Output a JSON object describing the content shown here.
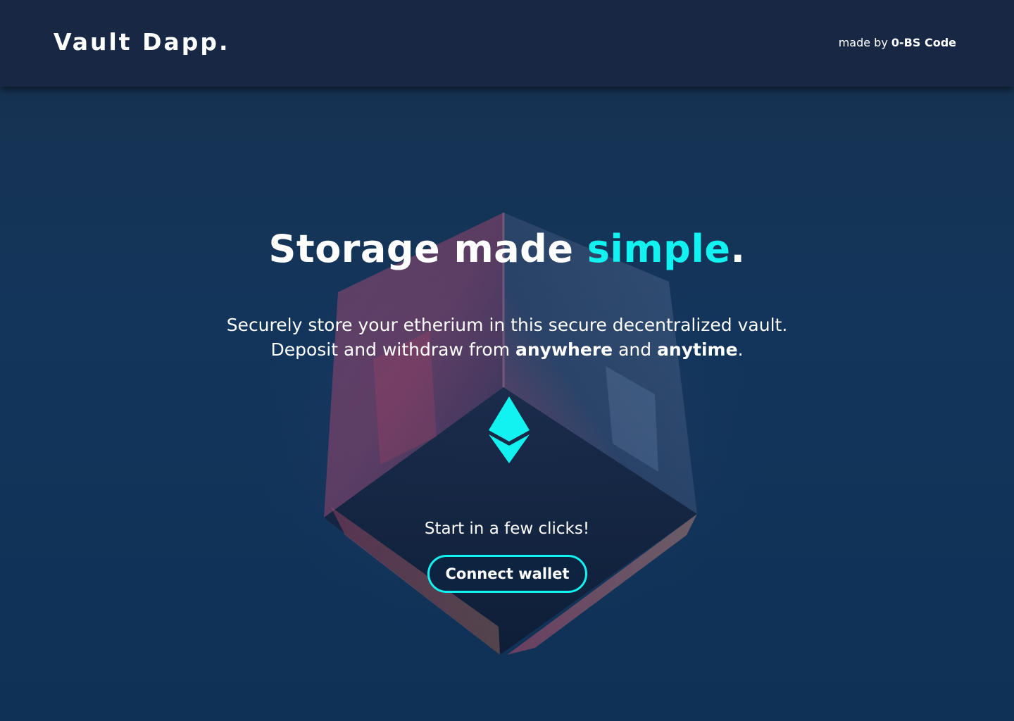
{
  "header": {
    "logo": "Vault Dapp.",
    "credit_prefix": "made by",
    "credit_brand": "0-BS Code"
  },
  "hero": {
    "title_main": "Storage made",
    "title_accent": "simple",
    "title_end": ".",
    "subtitle_line1": "Securely store your etherium in this secure decentralized vault.",
    "subtitle_line2_a": "Deposit and withdraw from",
    "subtitle_line2_b": "anywhere",
    "subtitle_line2_c": "and",
    "subtitle_line2_d": "anytime",
    "subtitle_line2_e": ".",
    "icon": "ethereum-icon",
    "cta_prompt": "Start in a few clicks!",
    "cta_button": "Connect wallet"
  },
  "colors": {
    "accent": "#12f3f1",
    "header_bg": "#182844",
    "page_bg": "#13355b"
  }
}
